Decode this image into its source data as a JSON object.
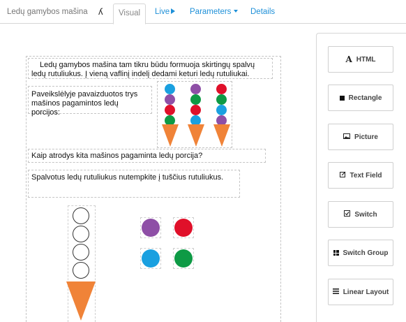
{
  "nav": {
    "title": "Ledų gamybos mašina",
    "glyph": "ʎ",
    "tabs": [
      {
        "label": "Visual",
        "active": true
      },
      {
        "label": "Live"
      },
      {
        "label": "Parameters"
      },
      {
        "label": "Details"
      }
    ]
  },
  "content": {
    "intro": "Ledų gamybos mašina tam tikru būdu formuoja skirtingų spalvų ledų rutuliukus. Į vieną vaflinį indelį dedami keturi ledų rutuliukai.",
    "picture_caption": "Paveikslėlyje pavaizduotos trys mašinos pagamintos ledų porcijos:",
    "question": "Kaip atrodys kita mašinos pagaminta ledų porcija?",
    "instruction": "Spalvotus ledų rutuliukus nutempkite į tuščius rutuliukus.",
    "portions": [
      {
        "scoops": [
          "blue",
          "purple",
          "red",
          "green"
        ]
      },
      {
        "scoops": [
          "purple",
          "green",
          "red",
          "blue"
        ]
      },
      {
        "scoops": [
          "red",
          "green",
          "blue",
          "purple"
        ]
      }
    ],
    "target_cone": {
      "empty_scoops": 4
    },
    "draggable_balls": [
      "purple",
      "red",
      "blue",
      "green"
    ]
  },
  "colors": {
    "blue": "#1aa0e0",
    "purple": "#8e4fa6",
    "red": "#e0102a",
    "green": "#0e9a45",
    "cone": "#f08338",
    "link": "#1e90d8"
  },
  "palette": {
    "items": [
      {
        "label": "HTML",
        "icon": "html-icon"
      },
      {
        "label": "Rectangle",
        "icon": "rectangle-icon"
      },
      {
        "label": "Picture",
        "icon": "picture-icon"
      },
      {
        "label": "Text Field",
        "icon": "text-field-icon"
      },
      {
        "label": "Switch",
        "icon": "switch-icon"
      },
      {
        "label": "Switch Group",
        "icon": "switch-group-icon"
      },
      {
        "label": "Linear Layout",
        "icon": "linear-layout-icon"
      }
    ]
  }
}
